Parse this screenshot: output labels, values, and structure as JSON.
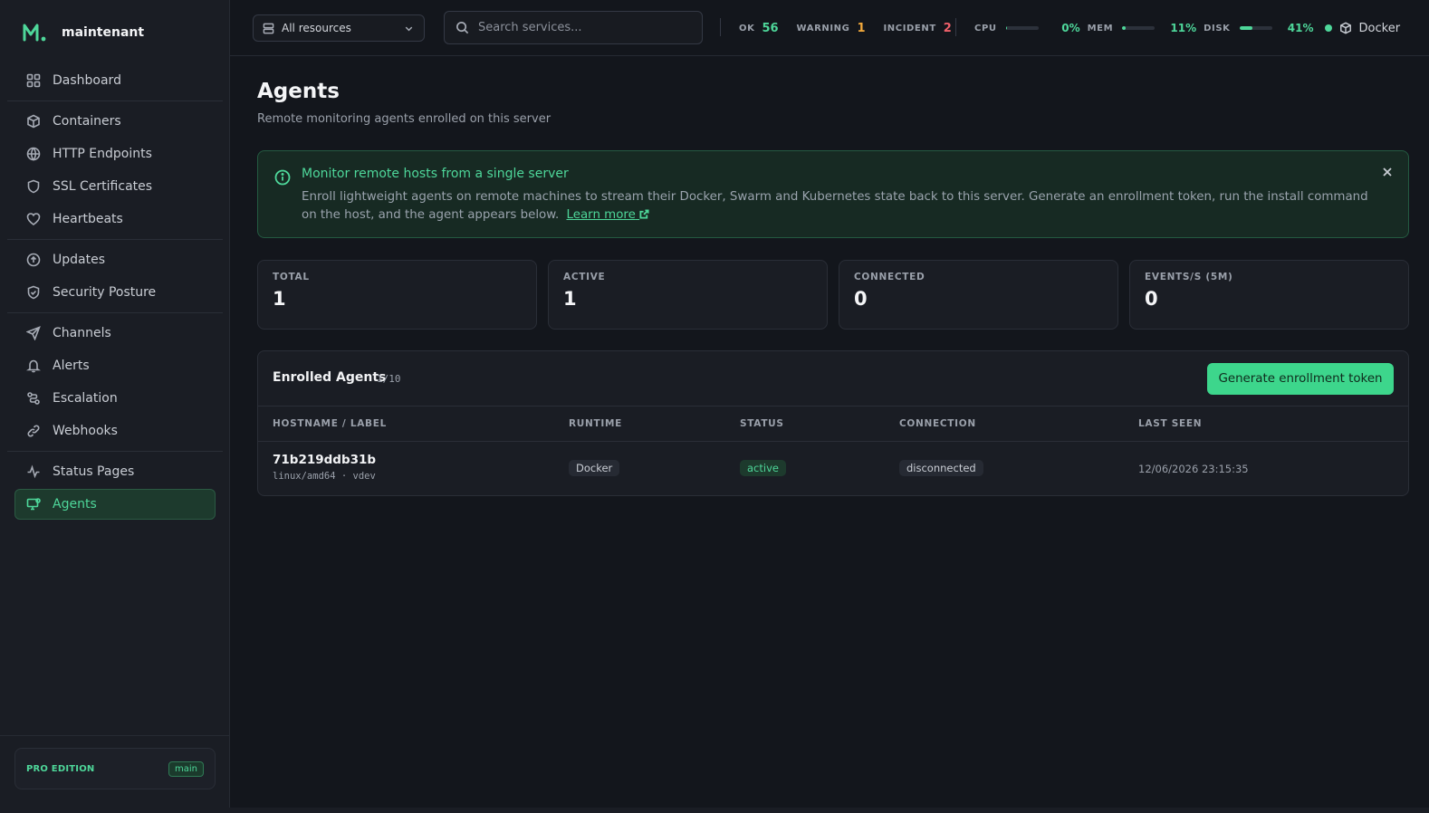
{
  "brand": {
    "name": "maintenant",
    "accent": "#4ed79a"
  },
  "sidebar": {
    "groups": [
      [
        {
          "label": "Dashboard",
          "icon": "grid-icon"
        }
      ],
      [
        {
          "label": "Containers",
          "icon": "box-icon"
        },
        {
          "label": "HTTP Endpoints",
          "icon": "globe-icon"
        },
        {
          "label": "SSL Certificates",
          "icon": "shield-icon"
        },
        {
          "label": "Heartbeats",
          "icon": "heart-icon"
        }
      ],
      [
        {
          "label": "Updates",
          "icon": "arrow-up-circle-icon"
        },
        {
          "label": "Security Posture",
          "icon": "shield-check-icon"
        }
      ],
      [
        {
          "label": "Channels",
          "icon": "send-icon"
        },
        {
          "label": "Alerts",
          "icon": "bell-icon"
        },
        {
          "label": "Escalation",
          "icon": "route-icon"
        },
        {
          "label": "Webhooks",
          "icon": "link-icon"
        }
      ],
      [
        {
          "label": "Status Pages",
          "icon": "activity-icon"
        },
        {
          "label": "Agents",
          "icon": "monitor-icon",
          "active": true
        }
      ]
    ],
    "edition_label": "PRO EDITION",
    "edition_badge": "main"
  },
  "topbar": {
    "resource_select": "All resources",
    "search_placeholder": "Search services...",
    "status": {
      "ok_label": "OK",
      "ok_value": "56",
      "ok_color": "#4ed79a",
      "warning_label": "WARNING",
      "warning_value": "1",
      "warning_color": "#f2a93b",
      "incident_label": "INCIDENT",
      "incident_value": "2",
      "incident_color": "#f0606a"
    },
    "resources": {
      "cpu_label": "CPU",
      "cpu_value": "0%",
      "cpu_pct": 0,
      "mem_label": "MEM",
      "mem_value": "11%",
      "mem_pct": 11,
      "disk_label": "DISK",
      "disk_value": "41%",
      "disk_pct": 41
    },
    "runtime_label": "Docker"
  },
  "page": {
    "title": "Agents",
    "subtitle": "Remote monitoring agents enrolled on this server"
  },
  "info_banner": {
    "title": "Monitor remote hosts from a single server",
    "body": "Enroll lightweight agents on remote machines to stream their Docker, Swarm and Kubernetes state back to this server. Generate an enrollment token, run the install command on the host, and the agent appears below.",
    "link_label": "Learn more"
  },
  "summary_cards": [
    {
      "label": "TOTAL",
      "value": "1"
    },
    {
      "label": "ACTIVE",
      "value": "1"
    },
    {
      "label": "CONNECTED",
      "value": "0"
    },
    {
      "label": "EVENTS/S (5M)",
      "value": "0"
    }
  ],
  "agents_table": {
    "title": "Enrolled Agents",
    "count": "1/10",
    "generate_button": "Generate enrollment token",
    "columns": [
      "HOSTNAME / LABEL",
      "RUNTIME",
      "STATUS",
      "CONNECTION",
      "LAST SEEN"
    ],
    "rows": [
      {
        "hostname": "71b219ddb31b",
        "platform": "linux/amd64 · vdev",
        "runtime": "Docker",
        "status": "active",
        "connection": "disconnected",
        "last_seen": "12/06/2026 23:15:35"
      }
    ]
  }
}
